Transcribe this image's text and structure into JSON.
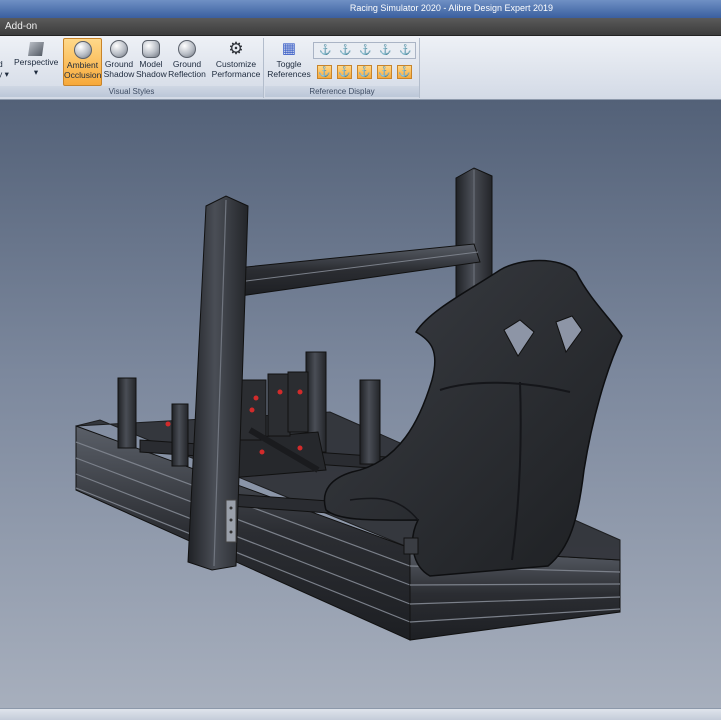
{
  "window": {
    "title": "Racing Simulator 2020 - Alibre Design Expert 2019"
  },
  "ribbon": {
    "active_tab": "Add-on",
    "groups": {
      "visual_styles": {
        "label": "Visual Styles",
        "buttons": {
          "display": {
            "line1": "d",
            "line2": "y ▾"
          },
          "perspective": {
            "line1": "Perspective",
            "line2": "▾"
          },
          "ambient_occlusion": {
            "line1": "Ambient",
            "line2": "Occlusion",
            "active": true
          },
          "ground_shadow": {
            "line1": "Ground",
            "line2": "Shadow"
          },
          "model_shadow": {
            "line1": "Model",
            "line2": "Shadow"
          },
          "ground_reflection": {
            "line1": "Ground",
            "line2": "Reflection"
          },
          "customize_performance": {
            "line1": "Customize",
            "line2": "Performance"
          }
        }
      },
      "reference_display": {
        "label": "Reference Display",
        "toggle_references": {
          "line1": "Toggle",
          "line2": "References"
        },
        "icons_row1": [
          "⚓",
          "⚓",
          "⚓",
          "⚓",
          "⚓"
        ],
        "icons_row2": [
          "⚓",
          "⚓",
          "⚓",
          "⚓",
          "⚓"
        ]
      }
    }
  },
  "viewport": {
    "model": "racing simulator rig with bucket seat, pedal assembly and aluminium extrusion frame",
    "colors": {
      "frame": "#2f3136",
      "frame_highlight": "#7b808a",
      "seat": "#2a2c30",
      "constraint_marks": "#d22b2b"
    }
  }
}
